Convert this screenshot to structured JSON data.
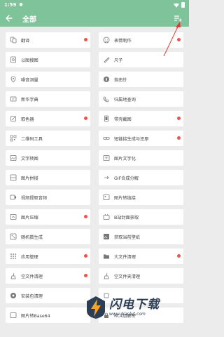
{
  "status_bar": {
    "time": "1:59",
    "indicator": "●"
  },
  "app_bar": {
    "title": "全部",
    "back_icon": "arrow-left-icon",
    "action_icon": "playlist-add-icon"
  },
  "colors": {
    "header": "#7fc39a",
    "badge": "#ef5350",
    "annotation_arrow": "#e53935",
    "background": "#ececec"
  },
  "tools": [
    {
      "label": "翻译",
      "icon": "translate-icon",
      "badge": true
    },
    {
      "label": "表情制作",
      "icon": "emoji-icon",
      "badge": true
    },
    {
      "label": "以图搜图",
      "icon": "image-search-icon",
      "badge": false
    },
    {
      "label": "尺子",
      "icon": "ruler-icon",
      "badge": false
    },
    {
      "label": "噪音测量",
      "icon": "noise-meter-icon",
      "badge": false
    },
    {
      "label": "指南针",
      "icon": "compass-icon",
      "badge": false
    },
    {
      "label": "新华字典",
      "icon": "dictionary-icon",
      "badge": false
    },
    {
      "label": "归属地查询",
      "icon": "phone-location-icon",
      "badge": false
    },
    {
      "label": "取色器",
      "icon": "color-picker-icon",
      "badge": true
    },
    {
      "label": "带壳截图",
      "icon": "phone-frame-screenshot-icon",
      "badge": true
    },
    {
      "label": "二维码工具",
      "icon": "qr-code-icon",
      "badge": false
    },
    {
      "label": "短链接生成与还原",
      "icon": "short-link-icon",
      "badge": true
    },
    {
      "label": "文字转图",
      "icon": "text-to-image-icon",
      "badge": false
    },
    {
      "label": "图片文字化",
      "icon": "image-to-text-icon",
      "badge": false
    },
    {
      "label": "图片拼接",
      "icon": "image-stitch-icon",
      "badge": false
    },
    {
      "label": "GIF合成分解",
      "icon": "gif-icon",
      "badge": false
    },
    {
      "label": "视频提取音频",
      "icon": "video-audio-icon",
      "badge": false
    },
    {
      "label": "图片转链接",
      "icon": "image-link-icon",
      "badge": false
    },
    {
      "label": "图片压缩",
      "icon": "image-compress-icon",
      "badge": true
    },
    {
      "label": "B站封面获取",
      "icon": "bilibili-cover-icon",
      "badge": false
    },
    {
      "label": "随机数生成",
      "icon": "dice-icon",
      "badge": false
    },
    {
      "label": "获取当前壁纸",
      "icon": "wallpaper-icon",
      "badge": false
    },
    {
      "label": "应用管理",
      "icon": "apps-icon",
      "badge": true
    },
    {
      "label": "大文件清理",
      "icon": "folder-icon",
      "badge": true
    },
    {
      "label": "空文件清理",
      "icon": "broom-icon",
      "badge": true
    },
    {
      "label": "空文件夹清理",
      "icon": "broom-folder-icon",
      "badge": false
    },
    {
      "label": "安装包清理",
      "icon": "package-icon",
      "badge": false
    },
    {
      "label": "",
      "icon": "generic-icon",
      "badge": false
    },
    {
      "label": "图片转Base64",
      "icon": "base64-icon",
      "badge": false
    },
    {
      "label": "RC4加解密",
      "icon": "lock-icon",
      "badge": false
    }
  ],
  "watermark": {
    "title": "闪电下载",
    "url": "www.dianlut.com",
    "logo_icon": "lightning-logo-icon"
  }
}
